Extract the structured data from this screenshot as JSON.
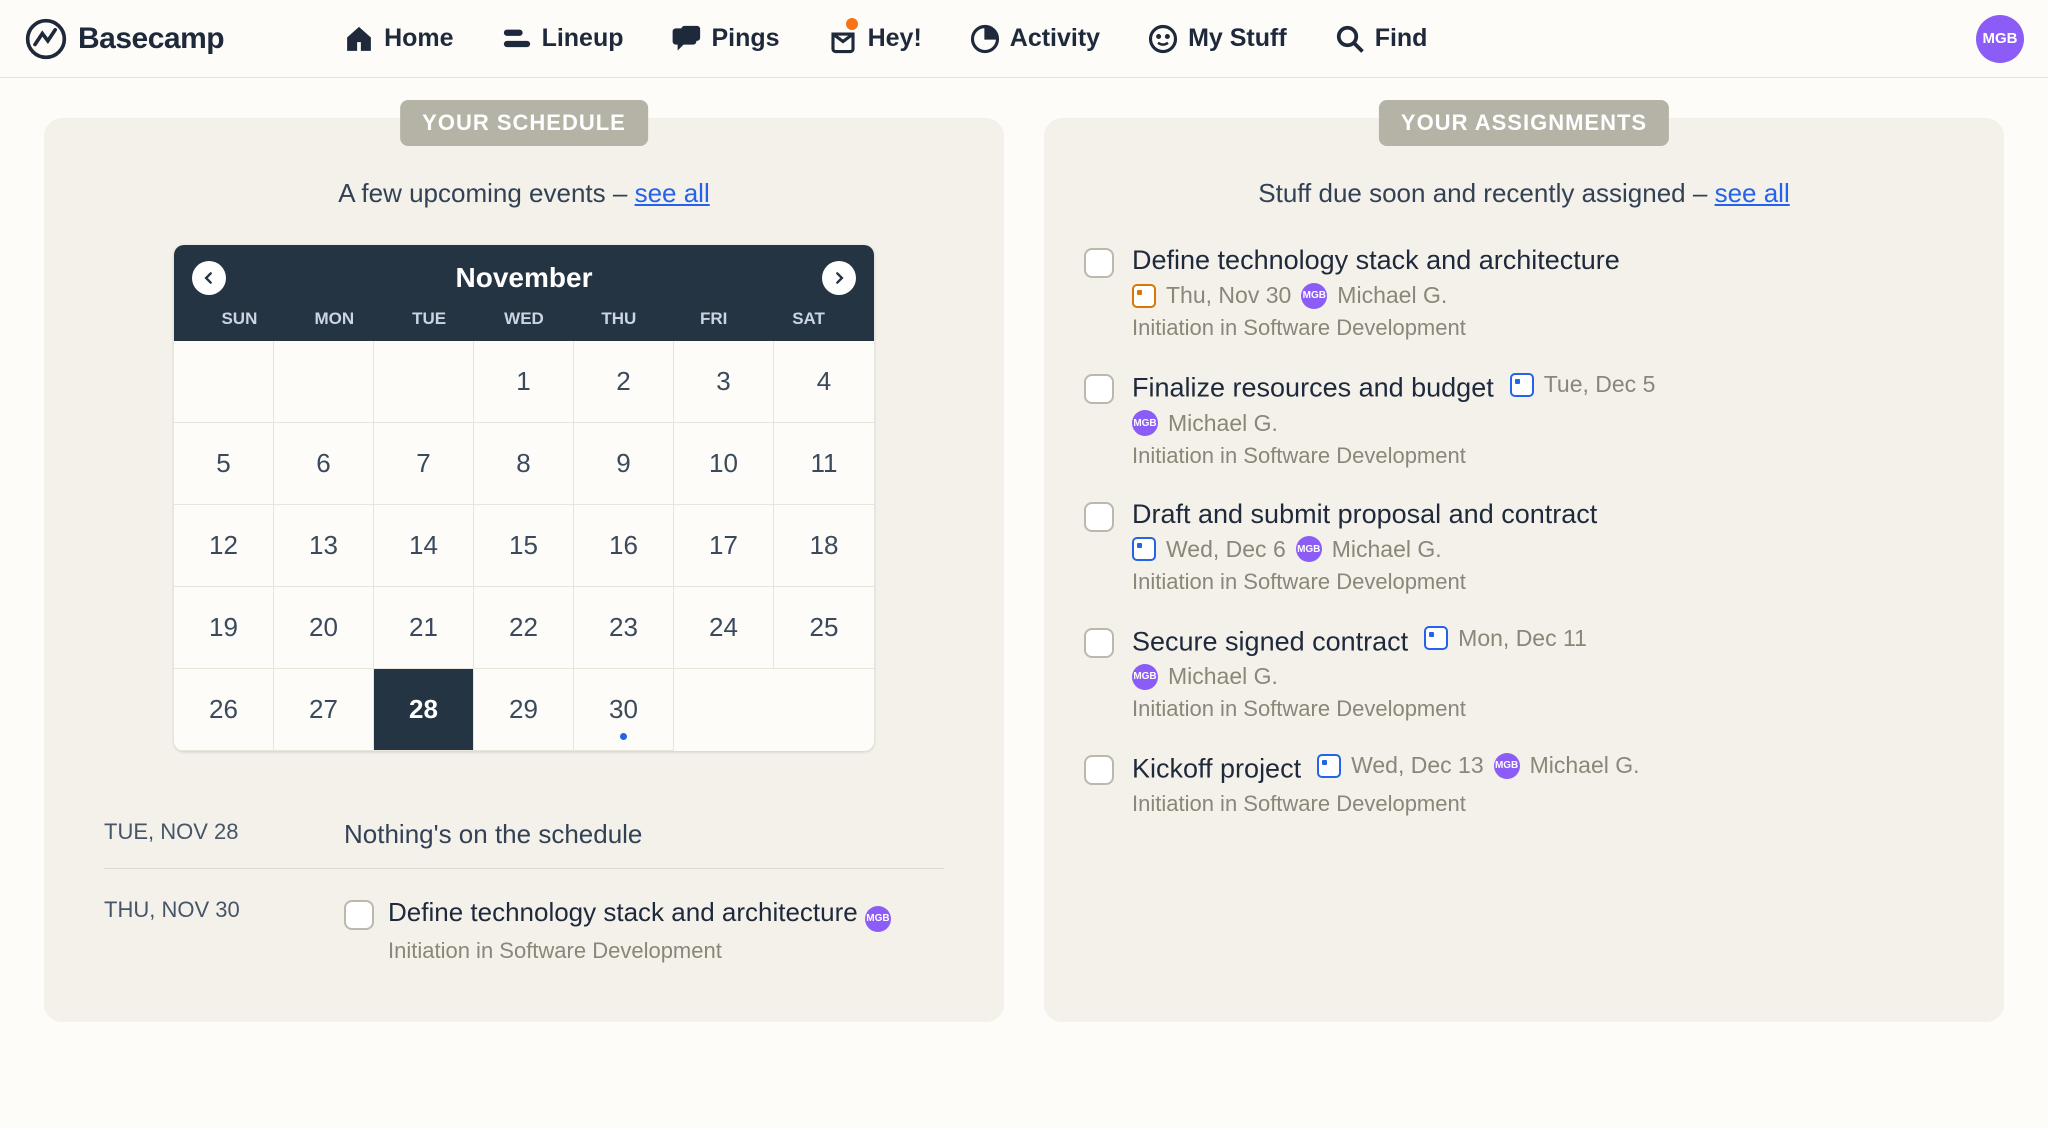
{
  "brand": "Basecamp",
  "avatar_initials": "MGB",
  "nav": {
    "home": "Home",
    "lineup": "Lineup",
    "pings": "Pings",
    "hey": "Hey!",
    "activity": "Activity",
    "my_stuff": "My Stuff",
    "find": "Find"
  },
  "schedule": {
    "badge": "YOUR SCHEDULE",
    "subtitle_prefix": "A few upcoming events – ",
    "subtitle_link": "see all",
    "calendar": {
      "month": "November",
      "weekdays": [
        "SUN",
        "MON",
        "TUE",
        "WED",
        "THU",
        "FRI",
        "SAT"
      ],
      "leading_blanks": 3,
      "days": 30,
      "today": 28,
      "dots": [
        30
      ]
    },
    "agenda": [
      {
        "date": "TUE, NOV 28",
        "empty": "Nothing's on the schedule"
      },
      {
        "date": "THU, NOV 30",
        "title": "Define technology stack and architecture",
        "assignee_initials": "MGB",
        "sub": "Initiation in Software Development"
      }
    ]
  },
  "assignments": {
    "badge": "YOUR ASSIGNMENTS",
    "subtitle_prefix": "Stuff due soon and recently assigned – ",
    "subtitle_link": "see all",
    "items": [
      {
        "title": "Define technology stack and architecture",
        "due": "Thu, Nov 30",
        "icon": "orange",
        "assignee": "Michael G.",
        "assignee_initials": "MGB",
        "sub": "Initiation in Software Development",
        "inline": false
      },
      {
        "title": "Finalize resources and budget",
        "due": "Tue, Dec 5",
        "icon": "blue",
        "assignee": "Michael G.",
        "assignee_initials": "MGB",
        "sub": "Initiation in Software Development",
        "inline": true
      },
      {
        "title": "Draft and submit proposal and contract",
        "due": "Wed, Dec 6",
        "icon": "blue",
        "assignee": "Michael G.",
        "assignee_initials": "MGB",
        "sub": "Initiation in Software Development",
        "inline": false
      },
      {
        "title": "Secure signed contract",
        "due": "Mon, Dec 11",
        "icon": "blue",
        "assignee": "Michael G.",
        "assignee_initials": "MGB",
        "sub": "Initiation in Software Development",
        "inline": true
      },
      {
        "title": "Kickoff project",
        "due": "Wed, Dec 13",
        "icon": "blue",
        "assignee": "Michael G.",
        "assignee_initials": "MGB",
        "sub": "Initiation in Software Development",
        "inline": true
      }
    ]
  }
}
